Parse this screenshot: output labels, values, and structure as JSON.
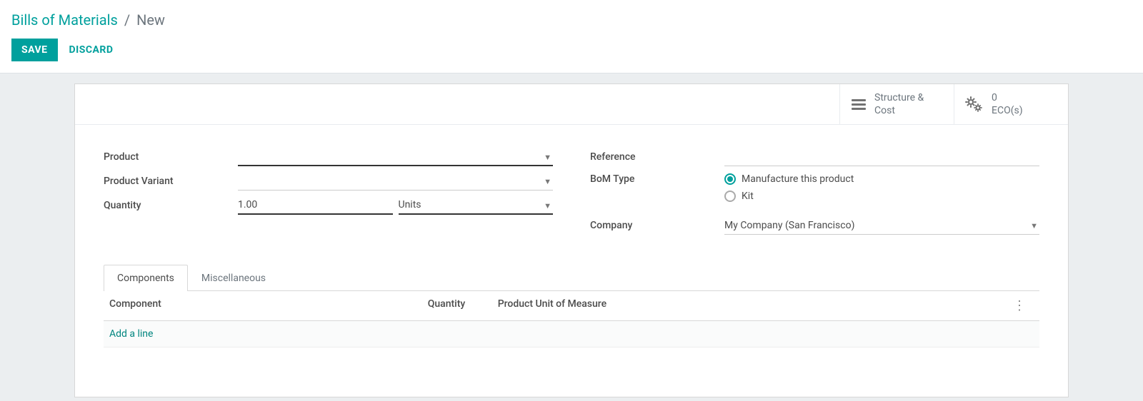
{
  "breadcrumb": {
    "parent": "Bills of Materials",
    "sep": "/",
    "current": "New"
  },
  "buttons": {
    "save": "SAVE",
    "discard": "DISCARD"
  },
  "stats": {
    "structure_line1": "Structure &",
    "structure_line2": "Cost",
    "eco_count": "0",
    "eco_label": "ECO(s)"
  },
  "labels": {
    "product": "Product",
    "product_variant": "Product Variant",
    "quantity": "Quantity",
    "reference": "Reference",
    "bom_type": "BoM Type",
    "company": "Company"
  },
  "fields": {
    "product": "",
    "product_variant": "",
    "quantity": "1.00",
    "quantity_unit": "Units",
    "reference": "",
    "company": "My Company (San Francisco)"
  },
  "bom_type": {
    "manufacture": "Manufacture this product",
    "kit": "Kit",
    "selected": "manufacture"
  },
  "tabs": {
    "components": "Components",
    "misc": "Miscellaneous"
  },
  "table": {
    "col_component": "Component",
    "col_quantity": "Quantity",
    "col_uom": "Product Unit of Measure",
    "add_line": "Add a line"
  }
}
